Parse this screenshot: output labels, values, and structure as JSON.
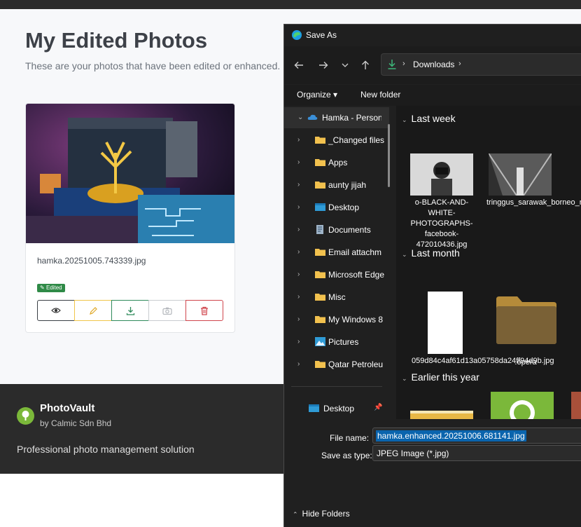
{
  "page": {
    "title": "My Edited Photos",
    "subtitle": "These are your photos that have been edited or enhanced.",
    "card": {
      "filename": "hamka.20251005.743339.jpg",
      "badge": "Edited",
      "actions": [
        "eye-icon",
        "pencil-icon",
        "download-icon",
        "camera-icon",
        "trash-icon"
      ]
    }
  },
  "footer": {
    "brand": "PhotoVault",
    "by": "by Calmic Sdn Bhd",
    "tagline": "Professional photo management solution"
  },
  "dialog": {
    "title": "Save As",
    "address": {
      "location": "Downloads"
    },
    "organize": "Organize ▾",
    "new_folder": "New folder",
    "nav": [
      {
        "label": "Hamka - Person",
        "chevron": "⌄",
        "icon": "onedrive-cloud-icon"
      },
      {
        "label": "_Changed files",
        "chevron": "›",
        "icon": "folder-icon"
      },
      {
        "label": "Apps",
        "chevron": "›",
        "icon": "folder-icon"
      },
      {
        "label": "aunty jijah",
        "chevron": "›",
        "icon": "folder-icon"
      },
      {
        "label": "Desktop",
        "chevron": "›",
        "icon": "desktop-icon"
      },
      {
        "label": "Documents",
        "chevron": "›",
        "icon": "documents-icon"
      },
      {
        "label": "Email attachm",
        "chevron": "›",
        "icon": "folder-icon"
      },
      {
        "label": "Microsoft Edge",
        "chevron": "›",
        "icon": "folder-icon"
      },
      {
        "label": "Misc",
        "chevron": "›",
        "icon": "folder-icon"
      },
      {
        "label": "My Windows 8",
        "chevron": "›",
        "icon": "folder-icon"
      },
      {
        "label": "Pictures",
        "chevron": "›",
        "icon": "pictures-icon"
      },
      {
        "label": "Qatar Petroleu",
        "chevron": "›",
        "icon": "folder-icon"
      }
    ],
    "quick_access": {
      "label": "Desktop",
      "pin": "📌"
    },
    "groups": {
      "last_week": "Last week",
      "last_month": "Last month",
      "earlier_this_year": "Earlier this year"
    },
    "files": {
      "f1": "o-BLACK-AND-WHITE-PHOTOGRAPHS-facebook-472010436.jpg",
      "f2": "tringgus_sarawak_borneo_malaysia_bridge_suspensionbridge_film.j...",
      "f3": "059d84c4af61d13a05758da24ff94d9b.jpg",
      "f4": ".opera"
    },
    "file_name_label": "File name:",
    "file_name_value": "hamka.enhanced.20251006.681141.jpg",
    "save_type_label": "Save as type:",
    "save_type_value": "JPEG Image (*.jpg)",
    "hide_folders": "Hide Folders"
  },
  "colors": {
    "accent_blue": "#0a64ad",
    "edited_badge": "#2f8a47",
    "footer_bg": "#2b2b2b",
    "dialog_bg": "#202020"
  }
}
